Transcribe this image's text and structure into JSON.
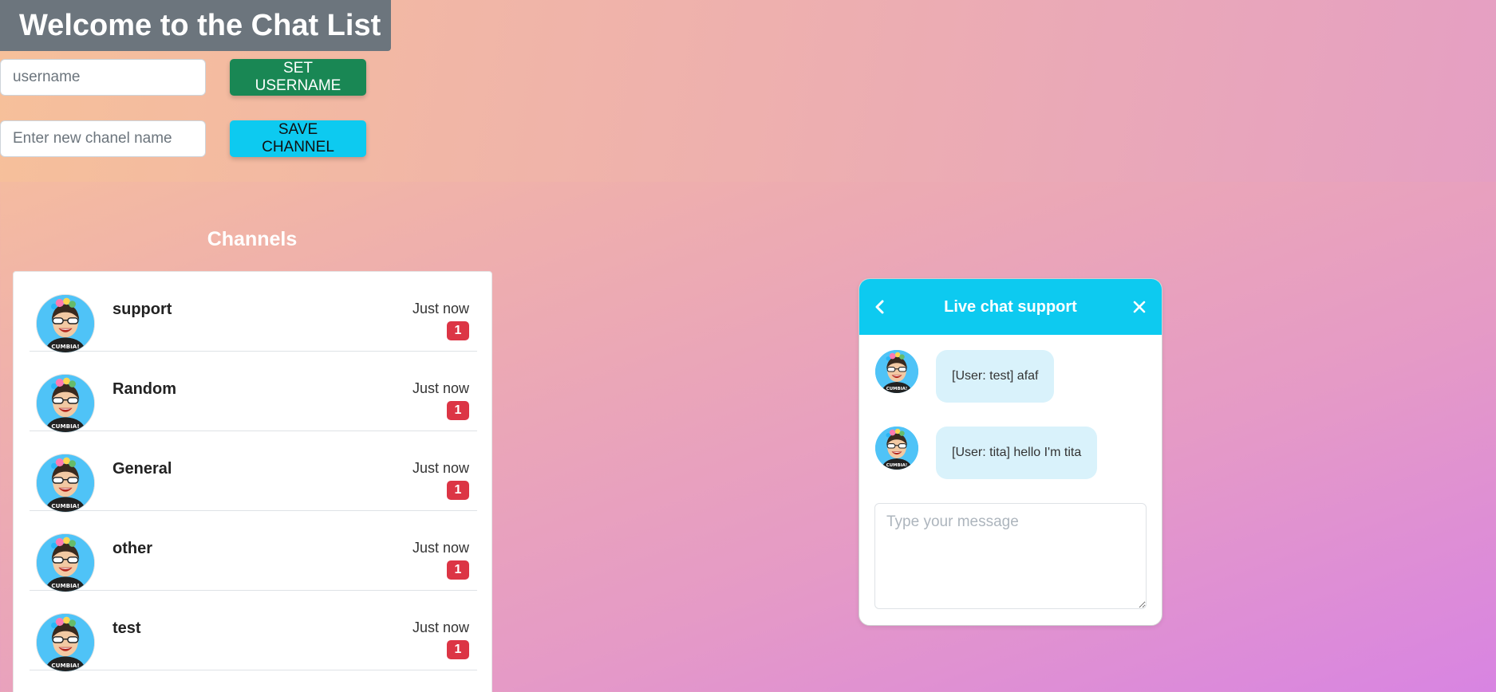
{
  "header": {
    "title": "Welcome to the Chat List",
    "username_placeholder": "username",
    "set_username_label": "SET USERNAME",
    "channel_placeholder": "Enter new chanel name",
    "save_channel_label": "SAVE CHANNEL"
  },
  "channels": {
    "heading": "Channels",
    "items": [
      {
        "name": "support",
        "time": "Just now",
        "unread": "1"
      },
      {
        "name": "Random",
        "time": "Just now",
        "unread": "1"
      },
      {
        "name": "General",
        "time": "Just now",
        "unread": "1"
      },
      {
        "name": "other",
        "time": "Just now",
        "unread": "1"
      },
      {
        "name": "test",
        "time": "Just now",
        "unread": "1"
      }
    ]
  },
  "chat": {
    "title": "Live chat support",
    "back_icon": "chevron-left-icon",
    "close_icon": "close-icon",
    "messages": [
      {
        "text": "[User: test] afaf"
      },
      {
        "text": "[User: tita] hello I'm tita"
      }
    ],
    "input_placeholder": "Type your message"
  },
  "colors": {
    "title_bg": "#6c757d",
    "green_button": "#198754",
    "cyan_accent": "#0dcaf0",
    "badge_red": "#dc3545",
    "bubble_bg": "#d9f2fb"
  }
}
